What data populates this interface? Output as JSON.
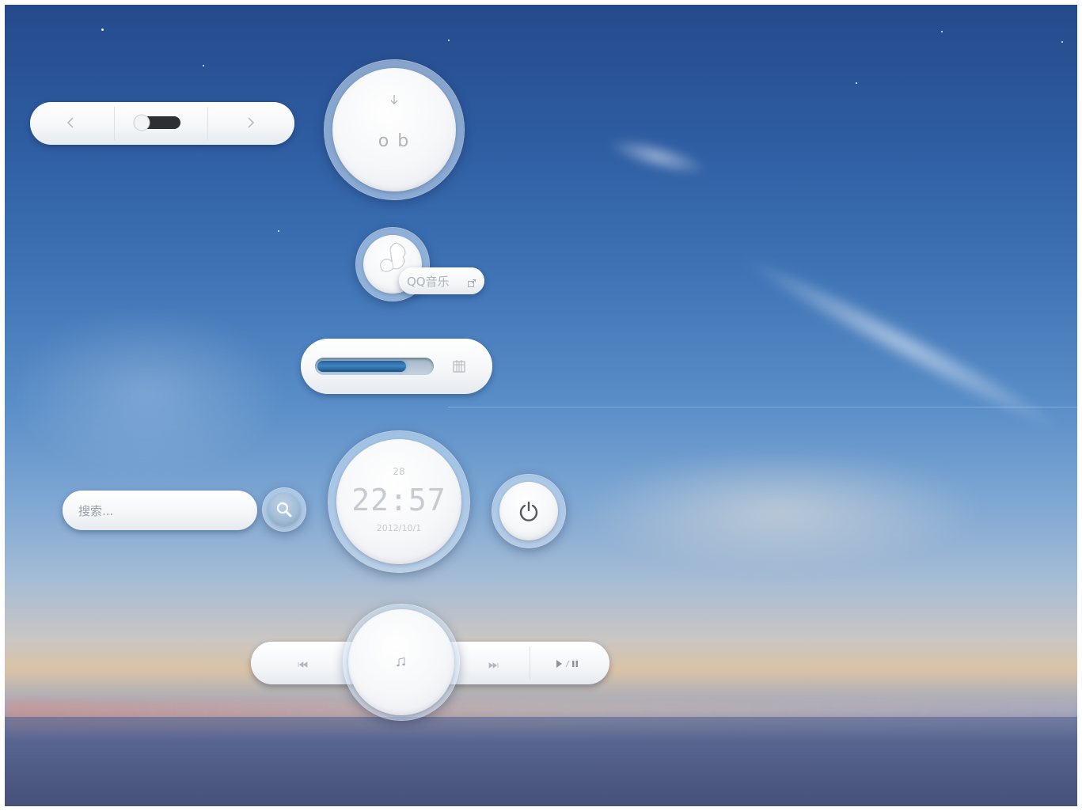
{
  "colors": {
    "glyph": "#a9aeb5",
    "progress_fill": "#3f86c4",
    "toggle_dark": "#2d2f33"
  },
  "nav_widget": {
    "prev_icon": "chevron-left-icon",
    "next_icon": "chevron-right-icon",
    "toggle_state": "on"
  },
  "dial_widget": {
    "arrow_icon": "arrow-down-icon",
    "text": "o b"
  },
  "music_widget": {
    "app_label": "QQ音乐",
    "open_icon": "external-link-icon"
  },
  "progress_widget": {
    "progress": 0.78,
    "calendar_icon": "calendar-icon"
  },
  "search_widget": {
    "placeholder": "搜索...",
    "search_icon": "search-icon"
  },
  "clock_widget": {
    "seconds": "28",
    "time": "22:57",
    "date": "2012/10/1"
  },
  "power_widget": {
    "icon": "power-icon"
  },
  "media_widget": {
    "prev_icon": "previous-track-icon",
    "center_icon": "music-note-icon",
    "next_icon": "next-track-icon",
    "play_pause_icon": "play-pause-icon"
  }
}
